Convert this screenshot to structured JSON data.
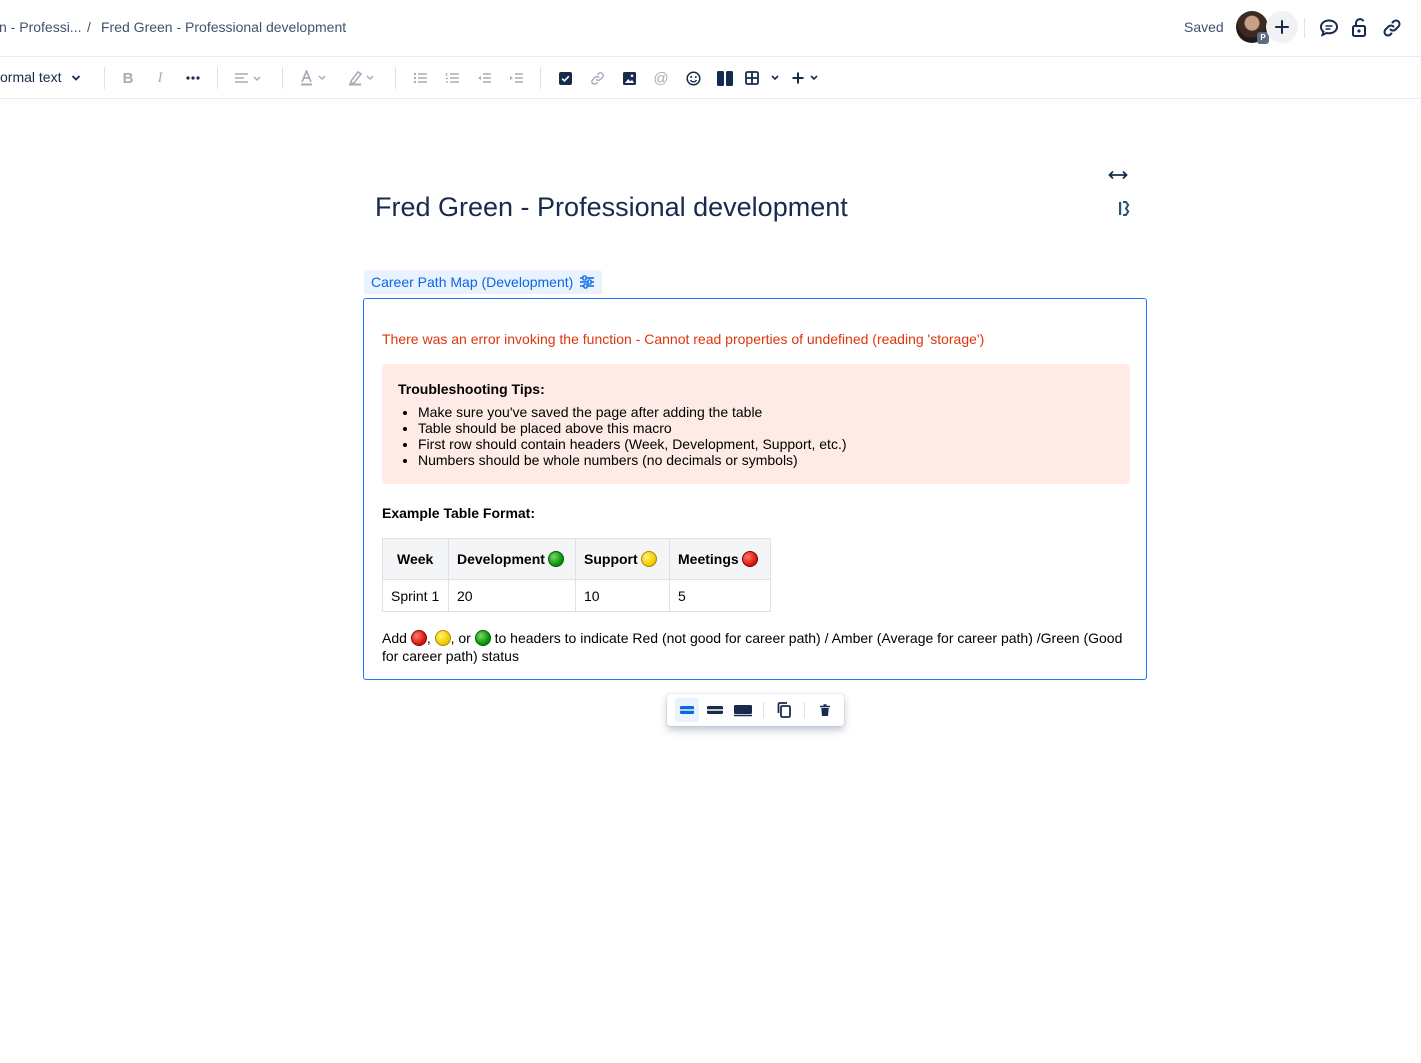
{
  "breadcrumb": {
    "parent": "n - Professi...",
    "separator": "/",
    "current": "Fred Green - Professional development"
  },
  "header": {
    "status": "Saved",
    "avatar_badge": "P"
  },
  "toolbar": {
    "text_style": "ormal text"
  },
  "page": {
    "title": "Fred Green - Professional development"
  },
  "macro": {
    "name": "Career Path Map (Development)",
    "error": "There was an error invoking the function - Cannot read properties of undefined (reading 'storage')",
    "tips_title": "Troubleshooting Tips:",
    "tips": [
      "Make sure you've saved the page after adding the table",
      "Table should be placed above this macro",
      "First row should contain headers (Week, Development, Support, etc.)",
      "Numbers should be whole numbers (no decimals or symbols)"
    ],
    "example_title": "Example Table Format:",
    "table": {
      "headers": [
        "Week",
        "Development",
        "Support",
        "Meetings"
      ],
      "row": [
        "Sprint 1",
        "20",
        "10",
        "5"
      ]
    },
    "note": {
      "prefix": "Add",
      "sep1": ",",
      "sep2": ", or",
      "suffix": "to headers to indicate Red (not good for career path) / Amber (Average for career path) /Green (Good for career path) status"
    }
  },
  "colors": {
    "accent": "#0c66e4",
    "error": "#de350b",
    "tips_bg": "#ffebe6",
    "status_green": "#0a9a0a",
    "status_amber": "#f5cc00",
    "status_red": "#dd1a10"
  }
}
